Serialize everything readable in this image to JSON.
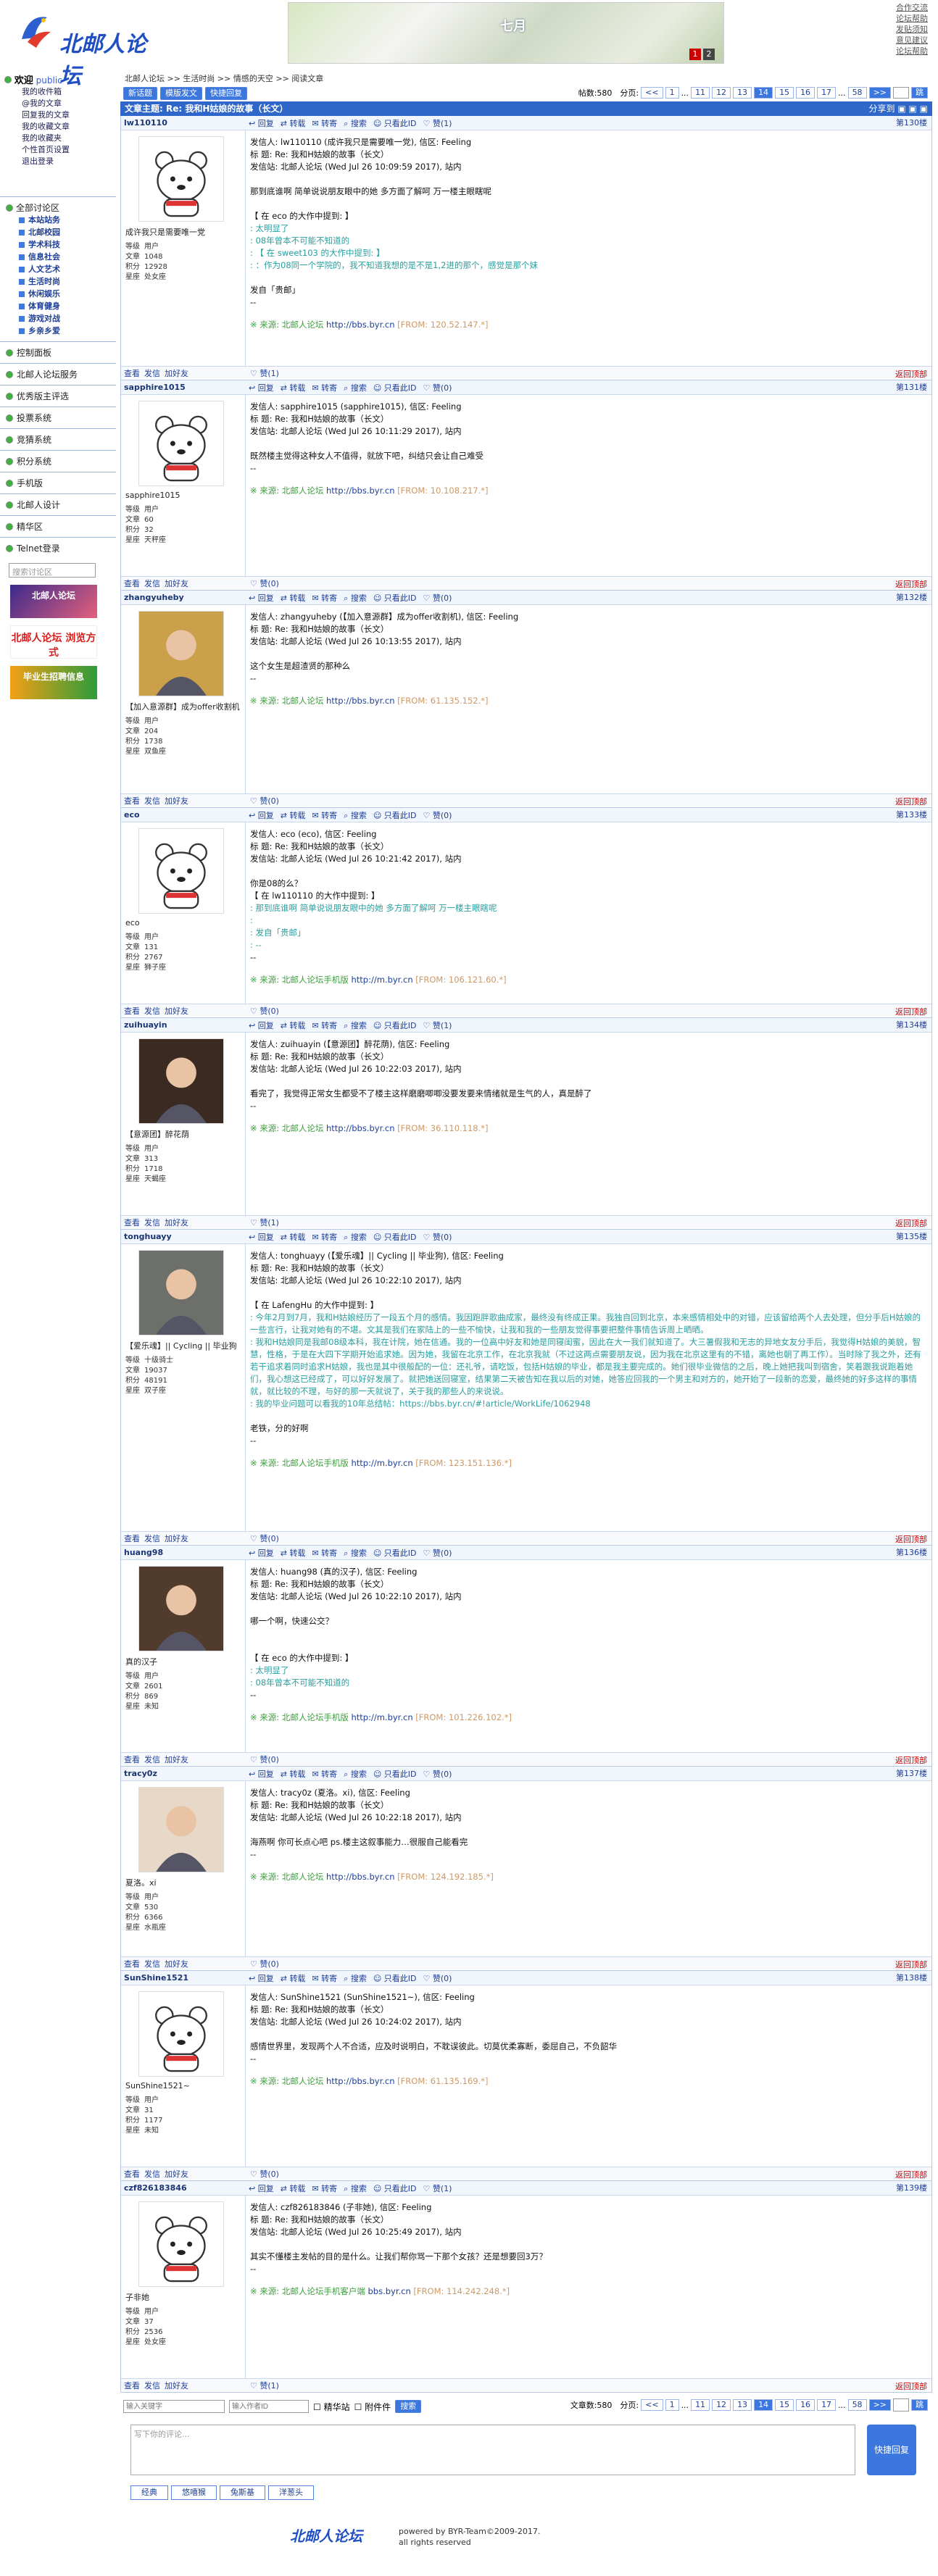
{
  "site": {
    "logo": "北邮人论坛",
    "banner_text": "七月",
    "banner_pages": [
      "1",
      "2"
    ],
    "top_links": [
      "合作交流",
      "论坛帮助",
      "发贴须知",
      "意见建议",
      "论坛帮助"
    ]
  },
  "sidebar": {
    "welcome": "欢迎",
    "user": "public",
    "menu": [
      "我的收件箱",
      "@我的文章",
      "回复我的文章",
      "我的收藏文章",
      "我的收藏夹",
      "个性首页设置",
      "退出登录"
    ],
    "all_sections": "全部讨论区",
    "sections": [
      "本站站务",
      "北邮校园",
      "学术科技",
      "信息社会",
      "人文艺术",
      "生活时尚",
      "休闲娱乐",
      "体育健身",
      "游戏对战",
      "乡亲乡爱"
    ],
    "rows": [
      "控制面板",
      "北邮人论坛服务",
      "优秀版主评选",
      "投票系统",
      "竞猜系统",
      "积分系统",
      "手机版",
      "北邮人设计",
      "精华区",
      "Telnet登录"
    ],
    "search_placeholder": "搜索讨论区",
    "ads": [
      "北邮人论坛",
      "北邮人论坛 浏览方式",
      "毕业生招聘信息"
    ]
  },
  "crumb": "北邮人论坛 >> 生活时尚 >> 情感的天空 >> 阅读文章",
  "toolbar": {
    "buttons": [
      "新话题",
      "模版发文",
      "快捷回复"
    ],
    "count_label": "帖数:580",
    "page_label": "分页:",
    "pages": [
      "<<",
      "1",
      "...",
      "11",
      "12",
      "13",
      "14",
      "15",
      "16",
      "17",
      "...",
      "58",
      ">>"
    ],
    "current": "14",
    "go": "跳"
  },
  "title": {
    "text": "文章主题: Re: 我和H姑娘的故事（长文）",
    "share": "分享到"
  },
  "actions": [
    "回复",
    "转载",
    "转寄",
    "搜索",
    "只看此ID",
    "赞(1)"
  ],
  "footer_actions": [
    "查看",
    "发信",
    "加好友"
  ],
  "back_top": "返回顶部",
  "posts": [
    {
      "user": "lw110110",
      "nick": "成许我只是需要唯一党",
      "stats": [
        "用户",
        "1048",
        "12928",
        "处女座"
      ],
      "floor": "第130楼",
      "likes": "赞(1)",
      "lines": [
        "发信人: lw110110 (成许我只是需要唯一党), 信区: Feeling",
        "标 题: Re: 我和H姑娘的故事（长文）",
        "发信站: 北邮人论坛 (Wed Jul 26 10:09:59 2017), 站内",
        "",
        "那到底谁啊 简单说说朋友眼中的她 多方面了解呵 万一楼主眼瞎呢",
        "",
        "【 在 eco 的大作中提到: 】"
      ],
      "quote": [
        ": 太明显了",
        ": 08年曾本不可能不知道的",
        ": 【 在 sweet103 的大作中提到: 】",
        ": ：作为08同一个学院的，我不知道我想的是不是1,2进的那个，感觉是那个妹"
      ],
      "tail": [
        "",
        "发自「贵邮」",
        "--"
      ],
      "src": "※ 来源: 北邮人论坛 ",
      "url": "http://bbs.byr.cn",
      "from": " [FROM: 120.52.147.*]"
    },
    {
      "user": "sapphire1015",
      "nick": "sapphire1015",
      "stats": [
        "用户",
        "60",
        "32",
        "天秤座"
      ],
      "floor": "第131楼",
      "likes": "赞(0)",
      "lines": [
        "发信人: sapphire1015 (sapphire1015), 信区: Feeling",
        "标 题: Re: 我和H姑娘的故事（长文）",
        "发信站: 北邮人论坛 (Wed Jul 26 10:11:29 2017), 站内",
        "",
        "既然楼主觉得这种女人不值得，就放下吧，纠结只会让自己难受",
        "--"
      ],
      "quote": [],
      "tail": [],
      "src": "※ 来源: 北邮人论坛 ",
      "url": "http://bbs.byr.cn",
      "from": " [FROM: 10.108.217.*]"
    },
    {
      "user": "zhangyuheby",
      "nick": "【加入意源群】成为offer收割机",
      "stats": [
        "用户",
        "204",
        "1738",
        "双鱼座"
      ],
      "floor": "第132楼",
      "likes": "赞(0)",
      "lines": [
        "发信人: zhangyuheby (【加入意源群】成为offer收割机), 信区: Feeling",
        "标 题: Re: 我和H姑娘的故事（长文）",
        "发信站: 北邮人论坛 (Wed Jul 26 10:13:55 2017), 站内",
        "",
        "这个女生是超渣贤的那种么",
        "--"
      ],
      "quote": [],
      "tail": [],
      "src": "※ 来源: 北邮人论坛 ",
      "url": "http://bbs.byr.cn",
      "from": " [FROM: 61.135.152.*]"
    },
    {
      "user": "eco",
      "nick": "eco",
      "stats": [
        "用户",
        "131",
        "2767",
        "狮子座"
      ],
      "floor": "第133楼",
      "likes": "赞(0)",
      "lines": [
        "发信人: eco (eco), 信区: Feeling",
        "标 题: Re: 我和H姑娘的故事（长文）",
        "发信站: 北邮人论坛 (Wed Jul 26 10:21:42 2017), 站内",
        "",
        "你是08的么？",
        "【 在 lw110110 的大作中提到: 】"
      ],
      "quote": [
        ": 那到底谁啊 简单说说朋友眼中的她 多方面了解呵 万一楼主眼瞎呢",
        ": ",
        ": 发自「贵邮」",
        ": --"
      ],
      "tail": [
        "--"
      ],
      "src": "※ 来源: 北邮人论坛手机版 ",
      "url": "http://m.byr.cn",
      "from": " [FROM: 106.121.60.*]"
    },
    {
      "user": "zuihuayin",
      "nick": "【意源团】醉花荫",
      "stats": [
        "用户",
        "313",
        "1718",
        "天蝎座"
      ],
      "floor": "第134楼",
      "likes": "赞(1)",
      "lines": [
        "发信人: zuihuayin (【意源团】醉花荫), 信区: Feeling",
        "标 题: Re: 我和H姑娘的故事（长文）",
        "发信站: 北邮人论坛 (Wed Jul 26 10:22:03 2017), 站内",
        "",
        "看完了，我觉得正常女生都受不了楼主这样磨磨唧唧没要发要来情绪就是生气的人，真是醉了",
        "--"
      ],
      "quote": [],
      "tail": [],
      "src": "※ 来源: 北邮人论坛 ",
      "url": "http://bbs.byr.cn",
      "from": " [FROM: 36.110.118.*]"
    },
    {
      "user": "tonghuayy",
      "nick": "【爱乐魂】|| Cycling || 毕业狗",
      "stats": [
        "十级骑士",
        "19037",
        "48191",
        "双子座"
      ],
      "floor": "第135楼",
      "likes": "赞(0)",
      "lines": [
        "发信人: tonghuayy (【爱乐魂】|| Cycling || 毕业狗), 信区: Feeling",
        "标 题: Re: 我和H姑娘的故事（长文）",
        "发信站: 北邮人论坛 (Wed Jul 26 10:22:10 2017), 站内",
        "",
        "【 在 LafengHu 的大作中提到: 】"
      ],
      "quote": [
        ": 今年2月到7月，我和H姑娘经历了一段五个月的感情。我因跑胖歌曲成家，最终没有终成正果。我独自回到北京，本来感情相处中的对错，应该留给两个人去处理，但分手后H姑娘的一些言行，让我对她有的不堪。文其是我们在家陆上的一些不愉快，让我和我的一些朋友觉得事要把整件事情告诉周上晒晒。",
        ": 我和H姑娘同是我邮08级本科，我在计院，她在信通。我的一位高中好友和她是同寝闺蜜，因此在大一我们就知道了。大三暑假我和无志的异地女友分手后，我觉得H姑娘的美貌，智慧，性格，于是在大四下学期开始追求她。因为她，我留在北京工作，在北京我就（不过这两点需要朋友说，因为我在北京这里有的不错，离她也朝了再工作）。当时除了我之外，还有若干追求着同时追求H姑娘，我也是其中很般配的一位：还礼爷，请吃饭，包括H姑娘的毕业，都是我主要完成的。她们很毕业微信的之后，晚上她把我叫到宿舍，笑着跟我说跑着她们，我心想这已经成了，可以好好发展了。就把她送回寝室，结果第二天被告知在我以后的对她，她答应回我的一个男主和对方的，她开始了一段新的恋爱，最终她的好多这样的事情就，就比较的不理，与好的那一天就说了，关于我的那些人的来说说。",
        ": 我的毕业问题可以看我的10年总结帖：https://bbs.byr.cn/#!article/WorkLife/1062948"
      ],
      "tail": [
        "",
        "老铁，分的好啊",
        "--"
      ],
      "src": "※ 来源: 北邮人论坛手机版 ",
      "url": "http://m.byr.cn",
      "from": " [FROM: 123.151.136.*]"
    },
    {
      "user": "huang98",
      "nick": "真的汉子",
      "stats": [
        "用户",
        "2601",
        "869",
        "未知"
      ],
      "floor": "第136楼",
      "likes": "赞(0)",
      "lines": [
        "发信人: huang98 (真的汉子), 信区: Feeling",
        "标 题: Re: 我和H姑娘的故事（长文）",
        "发信站: 北邮人论坛 (Wed Jul 26 10:22:10 2017), 站内",
        "",
        "哪一个啊，快速公交？",
        "",
        "",
        "【 在 eco 的大作中提到: 】"
      ],
      "quote": [
        ": 太明显了",
        ": 08年曾本不可能不知道的"
      ],
      "tail": [
        "--"
      ],
      "src": "※ 来源: 北邮人论坛手机版 ",
      "url": "http://m.byr.cn",
      "from": " [FROM: 101.226.102.*]"
    },
    {
      "user": "tracy0z",
      "nick": "夏洛。xi",
      "stats": [
        "用户",
        "530",
        "6366",
        "水瓶座"
      ],
      "floor": "第137楼",
      "likes": "赞(0)",
      "lines": [
        "发信人: tracy0z (夏洛。xi), 信区: Feeling",
        "标 题: Re: 我和H姑娘的故事（长文）",
        "发信站: 北邮人论坛 (Wed Jul 26 10:22:18 2017), 站内",
        "",
        "海燕啊 你可长点心吧 ps.楼主这叙事能力…很服自己能看完",
        "--"
      ],
      "quote": [],
      "tail": [],
      "src": "※ 来源: 北邮人论坛 ",
      "url": "http://bbs.byr.cn",
      "from": " [FROM: 124.192.185.*]"
    },
    {
      "user": "SunShine1521",
      "nick": "SunShine1521~",
      "stats": [
        "用户",
        "31",
        "1177",
        "未知"
      ],
      "floor": "第138楼",
      "likes": "赞(0)",
      "lines": [
        "发信人: SunShine1521 (SunShine1521~), 信区: Feeling",
        "标 题: Re: 我和H姑娘的故事（长文）",
        "发信站: 北邮人论坛 (Wed Jul 26 10:24:02 2017), 站内",
        "",
        "感情世界里，发现两个人不合适，应及时说明白，不耽误彼此。切莫优柔寡断，委屈自己，不负韶华",
        "--"
      ],
      "quote": [],
      "tail": [],
      "src": "※ 来源: 北邮人论坛 ",
      "url": "http://bbs.byr.cn",
      "from": " [FROM: 61.135.169.*]"
    },
    {
      "user": "czf826183846",
      "nick": "子非她",
      "stats": [
        "用户",
        "37",
        "2536",
        "处女座"
      ],
      "floor": "第139楼",
      "likes": "赞(1)",
      "lines": [
        "发信人: czf826183846 (子非她), 信区: Feeling",
        "标 题: Re: 我和H姑娘的故事（长文）",
        "发信站: 北邮人论坛 (Wed Jul 26 10:25:49 2017), 站内",
        "",
        "其实不懂楼主发帖的目的是什么。让我们帮你骂一下那个女孩？还是想要回3万？",
        "--"
      ],
      "quote": [],
      "tail": [],
      "src": "※ 来源: 北邮人论坛手机客户端 ",
      "url": "bbs.byr.cn",
      "from": " [FROM: 114.242.248.*]"
    }
  ],
  "stat_labels": [
    "等级",
    "文章",
    "积分",
    "星座"
  ],
  "bottom": {
    "input1": "输入关键字",
    "input2": "输入作者ID",
    "chk1": "精华站",
    "chk2": "附件件",
    "search": "搜索",
    "count_label": "文章数:580",
    "page_label": "分页:"
  },
  "reply": {
    "placeholder": "写下你的评论...",
    "button": "快捷回复",
    "tabs": [
      "经典",
      "悠嘻猴",
      "兔斯基",
      "洋葱头"
    ]
  },
  "footer": {
    "logo": "北邮人论坛",
    "line1": "powered by BYR-Team©2009-2017.",
    "line2": "all rights reserved"
  }
}
